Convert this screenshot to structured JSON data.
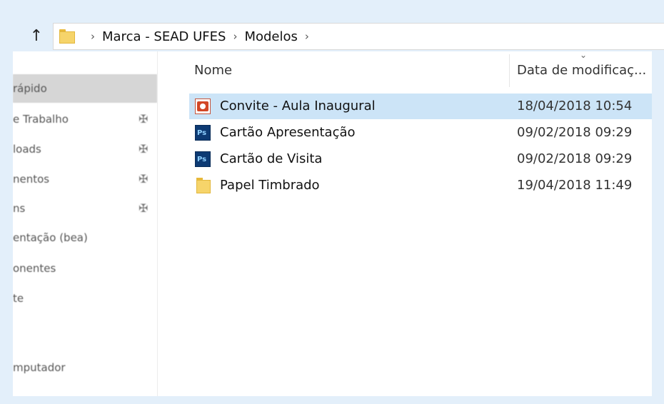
{
  "address_bar": {
    "crumbs": [
      "Marca - SEAD UFES",
      "Modelos"
    ]
  },
  "sidebar": {
    "items": [
      {
        "label": "rápido",
        "pinned": false,
        "selected": true
      },
      {
        "label": "e Trabalho",
        "pinned": true
      },
      {
        "label": "loads",
        "pinned": true
      },
      {
        "label": "nentos",
        "pinned": true
      },
      {
        "label": "ns",
        "pinned": true
      },
      {
        "label": "entação (bea)",
        "pinned": false
      },
      {
        "label": "onentes",
        "pinned": false
      },
      {
        "label": "te",
        "pinned": false
      },
      {
        "label": "mputador",
        "pinned": false
      }
    ]
  },
  "columns": {
    "name": "Nome",
    "date": "Data de modificaç..."
  },
  "files": [
    {
      "name": "Convite - Aula Inaugural",
      "date": "18/04/2018 10:54",
      "icon": "powerpoint-icon",
      "selected": true
    },
    {
      "name": "Cartão Apresentação",
      "date": "09/02/2018 09:29",
      "icon": "photoshop-icon"
    },
    {
      "name": "Cartão de Visita",
      "date": "09/02/2018 09:29",
      "icon": "photoshop-icon"
    },
    {
      "name": "Papel Timbrado",
      "date": "19/04/2018 11:49",
      "icon": "folder-icon"
    }
  ],
  "colors": {
    "background": "#e3effa",
    "selection": "#cce4f7",
    "sidebar_selection": "#d6d6d6"
  }
}
